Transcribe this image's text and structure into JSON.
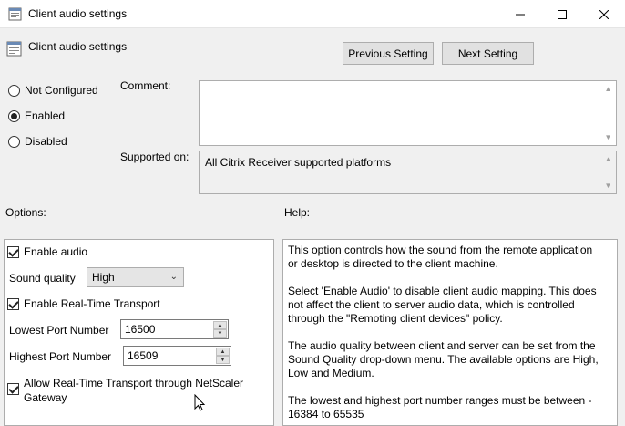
{
  "window": {
    "title": "Client audio settings",
    "controls": {
      "minimize": "—",
      "maximize": "☐",
      "close": "✕"
    }
  },
  "header": {
    "title": "Client audio settings",
    "previous_label": "Previous Setting",
    "next_label": "Next Setting"
  },
  "state": {
    "options": [
      "Not Configured",
      "Enabled",
      "Disabled"
    ],
    "selected": "Enabled"
  },
  "comment": {
    "label": "Comment:",
    "value": ""
  },
  "supported": {
    "label": "Supported on:",
    "value": "All Citrix Receiver supported platforms"
  },
  "sections": {
    "options": "Options:",
    "help": "Help:"
  },
  "options_panel": {
    "enable_audio": {
      "label": "Enable audio",
      "checked": true
    },
    "sound_quality": {
      "label": "Sound quality",
      "value": "High"
    },
    "enable_rtt": {
      "label": "Enable Real-Time Transport",
      "checked": true
    },
    "lowest_port": {
      "label": "Lowest Port Number",
      "value": "16500"
    },
    "highest_port": {
      "label": "Highest Port Number",
      "value": "16509"
    },
    "allow_rtt_netscaler": {
      "label_line1": "Allow Real-Time Transport through NetScaler",
      "label_line2": "Gateway",
      "checked": true
    }
  },
  "help": {
    "paragraphs": [
      "This option controls how the sound from the remote application or desktop is directed to the client machine.",
      "Select 'Enable Audio' to disable client audio mapping. This does not affect the client to server audio data, which is controlled through the \"Remoting client devices\" policy.",
      "The audio quality between client and server can be set from the Sound Quality drop-down menu. The available options are High, Low and Medium.",
      "The lowest and highest port number ranges must be between - 16384 to 65535"
    ]
  },
  "colors": {
    "accent": "#0078d7",
    "window_bg": "#f0f0f0",
    "border": "#adadad"
  },
  "icons": [
    "policy-icon",
    "minimize-icon",
    "maximize-icon",
    "close-icon",
    "mouse-cursor-icon"
  ]
}
